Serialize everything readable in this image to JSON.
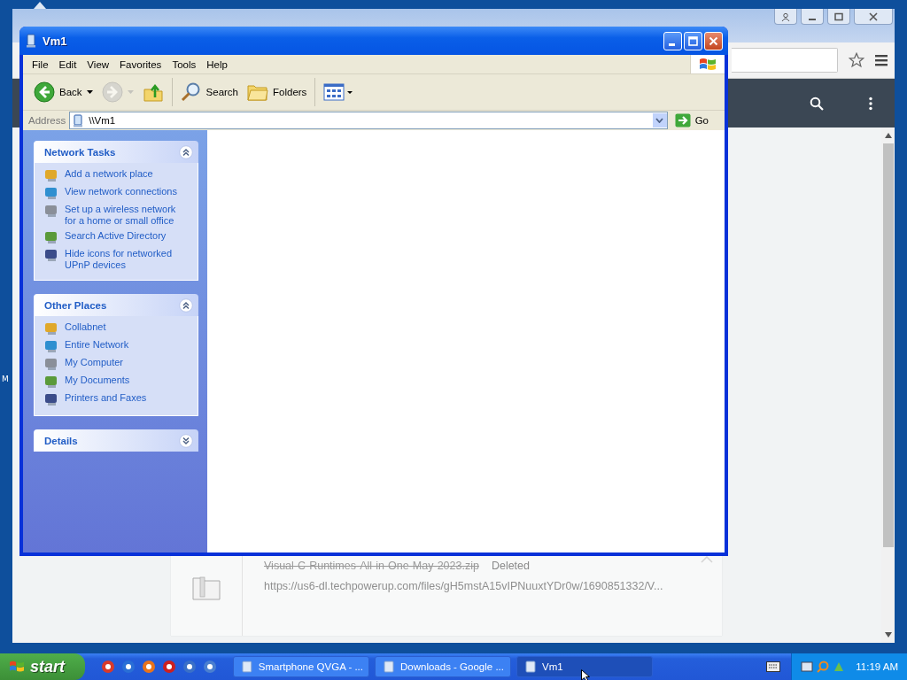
{
  "edge_text": "M",
  "browser": {
    "download": {
      "filename": "Visual-C-Runtimes-All-in-One-May-2023.zip",
      "status": "Deleted",
      "url": "https://us6-dl.techpowerup.com/files/gH5mstA15vIPNuuxtYDr0w/1690851332/V...",
      "deleted": true
    }
  },
  "explorer": {
    "title": "Vm1",
    "menu": [
      "File",
      "Edit",
      "View",
      "Favorites",
      "Tools",
      "Help"
    ],
    "toolbar": [
      {
        "kind": "back",
        "label": "Back",
        "disabled": false
      },
      {
        "kind": "forward",
        "disabled": true
      },
      {
        "kind": "up",
        "disabled": false
      },
      {
        "kind": "search",
        "label": "Search",
        "disabled": false
      },
      {
        "kind": "folders",
        "label": "Folders",
        "disabled": false
      },
      {
        "kind": "views",
        "disabled": false
      }
    ],
    "address": {
      "label": "Address",
      "value": "\\\\Vm1",
      "go": "Go"
    },
    "panels": [
      {
        "title": "Network Tasks",
        "expanded": true,
        "items": [
          "Add a network place",
          "View network connections",
          "Set up a wireless network for a home or small office",
          "Search Active Directory",
          "Hide icons for networked UPnP devices"
        ]
      },
      {
        "title": "Other Places",
        "expanded": true,
        "items": [
          "Collabnet",
          "Entire Network",
          "My Computer",
          "My Documents",
          "Printers and Faxes"
        ]
      },
      {
        "title": "Details",
        "expanded": false
      }
    ]
  },
  "taskbar": {
    "start": "start",
    "tasks": [
      {
        "label": "Smartphone QVGA - ...",
        "selected": false
      },
      {
        "label": "Downloads - Google ...",
        "selected": false
      },
      {
        "label": "Vm1",
        "selected": true
      }
    ],
    "clock": "11:19 AM"
  }
}
